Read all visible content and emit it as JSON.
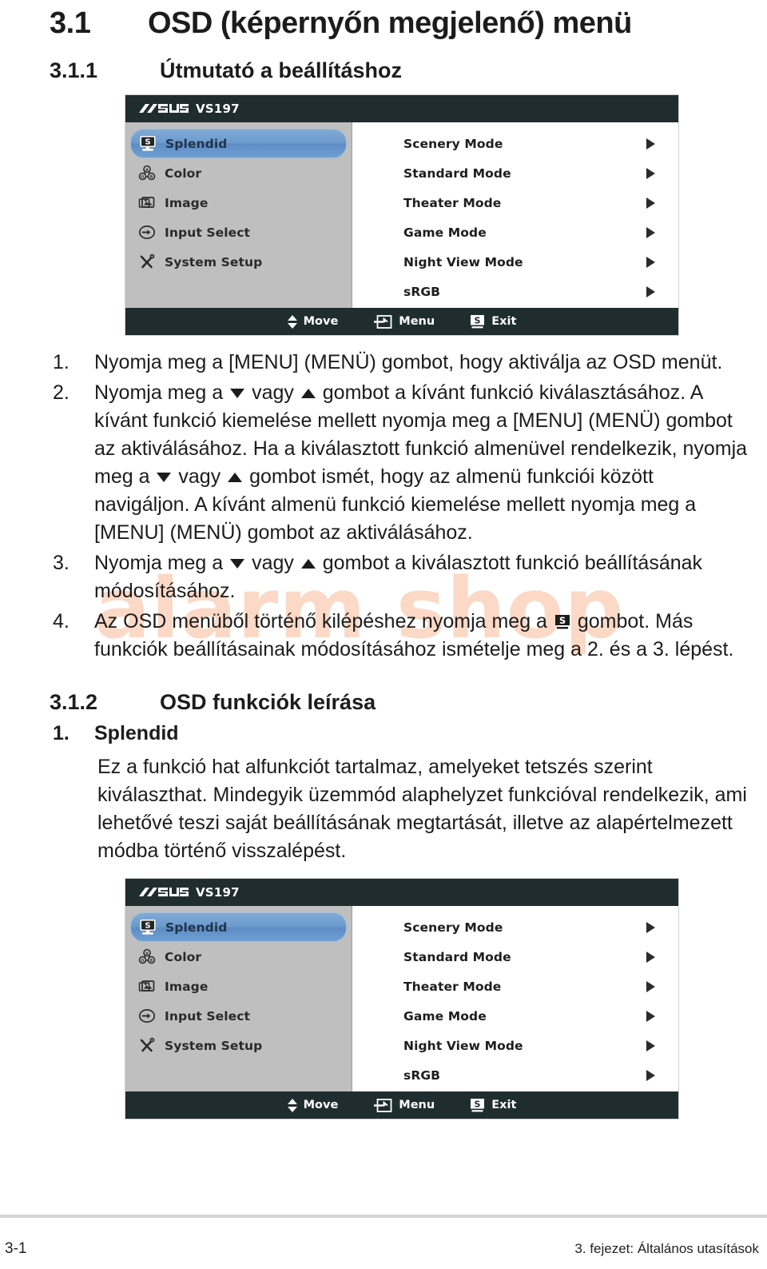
{
  "document": {
    "section_1": {
      "number": "3.1",
      "title": "OSD (képernyőn megjelenő) menü"
    },
    "section_1_1": {
      "number": "3.1.1",
      "title": "Útmutató a beállításhoz"
    },
    "section_1_2": {
      "number": "3.1.2",
      "title": "OSD funkciók leírása"
    },
    "watermark": "alarm shop"
  },
  "osd": {
    "brand_logo": "asus-logo",
    "model": "VS197",
    "sidebar": [
      {
        "label": "Splendid",
        "icon": "splendid-monitor-icon",
        "active": true
      },
      {
        "label": "Color",
        "icon": "color-rgb-icon",
        "active": false
      },
      {
        "label": "Image",
        "icon": "image-picture-icon",
        "active": false
      },
      {
        "label": "Input Select",
        "icon": "input-arrow-icon",
        "active": false
      },
      {
        "label": "System Setup",
        "icon": "wrench-screwdriver-icon",
        "active": false
      }
    ],
    "options": [
      {
        "label": "Scenery Mode",
        "arrow": "chevron-right-icon"
      },
      {
        "label": "Standard Mode",
        "arrow": "chevron-right-icon"
      },
      {
        "label": "Theater Mode",
        "arrow": "chevron-right-icon"
      },
      {
        "label": "Game Mode",
        "arrow": "chevron-right-icon"
      },
      {
        "label": "Night View Mode",
        "arrow": "chevron-right-icon"
      },
      {
        "label": "sRGB",
        "arrow": "chevron-right-icon"
      }
    ],
    "footer": [
      {
        "label": "Move",
        "icon": "up-down-arrows-icon"
      },
      {
        "label": "Menu",
        "icon": "menu-enter-icon"
      },
      {
        "label": "Exit",
        "icon": "splendid-s-icon"
      }
    ],
    "colors": {
      "titlebar": "#1f2d2e",
      "sidebar_bg": "#bfbfbf",
      "highlight": "#6b9acd",
      "panel_bg": "#ffffff"
    }
  },
  "steps": [
    {
      "n": "1.",
      "parts": [
        {
          "t": "text",
          "v": "Nyomja meg a [MENU] (MENÜ) gombot, hogy aktiválja az OSD menüt."
        }
      ]
    },
    {
      "n": "2.",
      "parts": [
        {
          "t": "text",
          "v": "Nyomja meg a "
        },
        {
          "t": "icon",
          "v": "triangle-down-icon"
        },
        {
          "t": "text",
          "v": " vagy "
        },
        {
          "t": "icon",
          "v": "triangle-up-icon"
        },
        {
          "t": "text",
          "v": " gombot a kívánt funkció kiválasztásához. A kívánt funkció kiemelése mellett nyomja meg a [MENU] (MENÜ) gombot az aktiválásához. Ha a kiválasztott funkció almenüvel rendelkezik, nyomja meg a "
        },
        {
          "t": "icon",
          "v": "triangle-down-icon"
        },
        {
          "t": "text",
          "v": " vagy "
        },
        {
          "t": "icon",
          "v": "triangle-up-icon"
        },
        {
          "t": "text",
          "v": " gombot ismét, hogy az almenü funkciói között navigáljon. A kívánt almenü funkció kiemelése mellett nyomja meg a [MENU] (MENÜ) gombot az aktiválásához."
        }
      ]
    },
    {
      "n": "3.",
      "parts": [
        {
          "t": "text",
          "v": "Nyomja meg a "
        },
        {
          "t": "icon",
          "v": "triangle-down-icon"
        },
        {
          "t": "text",
          "v": " vagy "
        },
        {
          "t": "icon",
          "v": "triangle-up-icon"
        },
        {
          "t": "text",
          "v": " gombot a kiválasztott funkció beállításának módosításához."
        }
      ]
    },
    {
      "n": "4.",
      "parts": [
        {
          "t": "text",
          "v": "Az OSD menüből történő kilépéshez nyomja meg a "
        },
        {
          "t": "icon",
          "v": "splendid-s-icon"
        },
        {
          "t": "text",
          "v": " gombot. Más funkciók beállításainak módosításához ismételje meg a 2. és a 3. lépést."
        }
      ]
    }
  ],
  "splendid": {
    "n": "1.",
    "title": "Splendid",
    "paragraph": "Ez a funkció hat alfunkciót tartalmaz, amelyeket tetszés szerint kiválaszthat. Mindegyik üzemmód alaphelyzet funkcióval rendelkezik, ami lehetővé teszi saját beállításának megtartását, illetve az alapértelmezett módba történő visszalépést."
  },
  "page_footer": {
    "page_number": "3-1",
    "chapter": "3. fejezet: Általános utasítások"
  }
}
